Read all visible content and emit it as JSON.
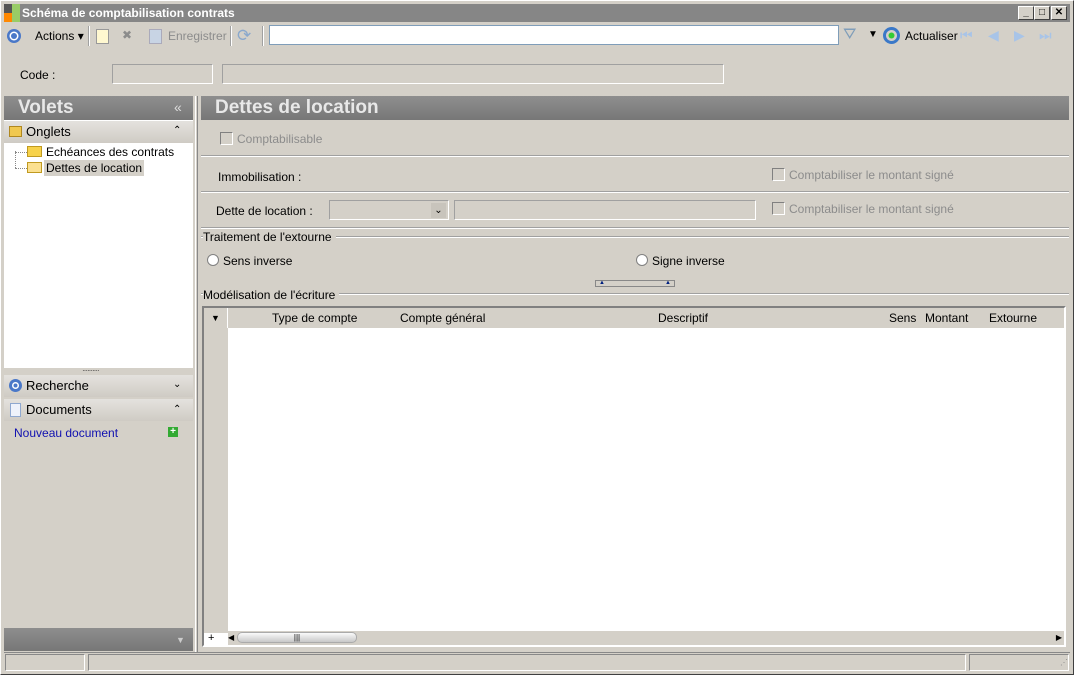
{
  "window": {
    "title": "Schéma de comptabilisation contrats"
  },
  "toolbar": {
    "actions": "Actions",
    "save": "Enregistrer",
    "search_value": "",
    "refresh": "Actualiser"
  },
  "header": {
    "code_label": "Code :",
    "code_value": "",
    "code_desc": ""
  },
  "sidebar": {
    "title": "Volets",
    "collapse": "«",
    "tabs_section": "Onglets",
    "tabs": [
      {
        "label": "Echéances des contrats"
      },
      {
        "label": "Dettes de location"
      }
    ],
    "search_section": "Recherche",
    "documents_section": "Documents",
    "new_document": "Nouveau document"
  },
  "main": {
    "title": "Dettes de location",
    "comptabilisable": "Comptabilisable",
    "immobilisation_label": "Immobilisation :",
    "signed_label_1": "Comptabiliser le montant signé",
    "dette_label": "Dette de location :",
    "signed_label_2": "Comptabiliser le montant signé",
    "extourne_group": "Traitement de l'extourne",
    "radio_sens": "Sens inverse",
    "radio_signe": "Signe inverse",
    "modelisation_group": "Modélisation de l'écriture",
    "grid": {
      "columns": [
        "Type de compte",
        "Compte général",
        "Descriptif",
        "Sens",
        "Montant",
        "Extourne"
      ],
      "rows": []
    }
  }
}
